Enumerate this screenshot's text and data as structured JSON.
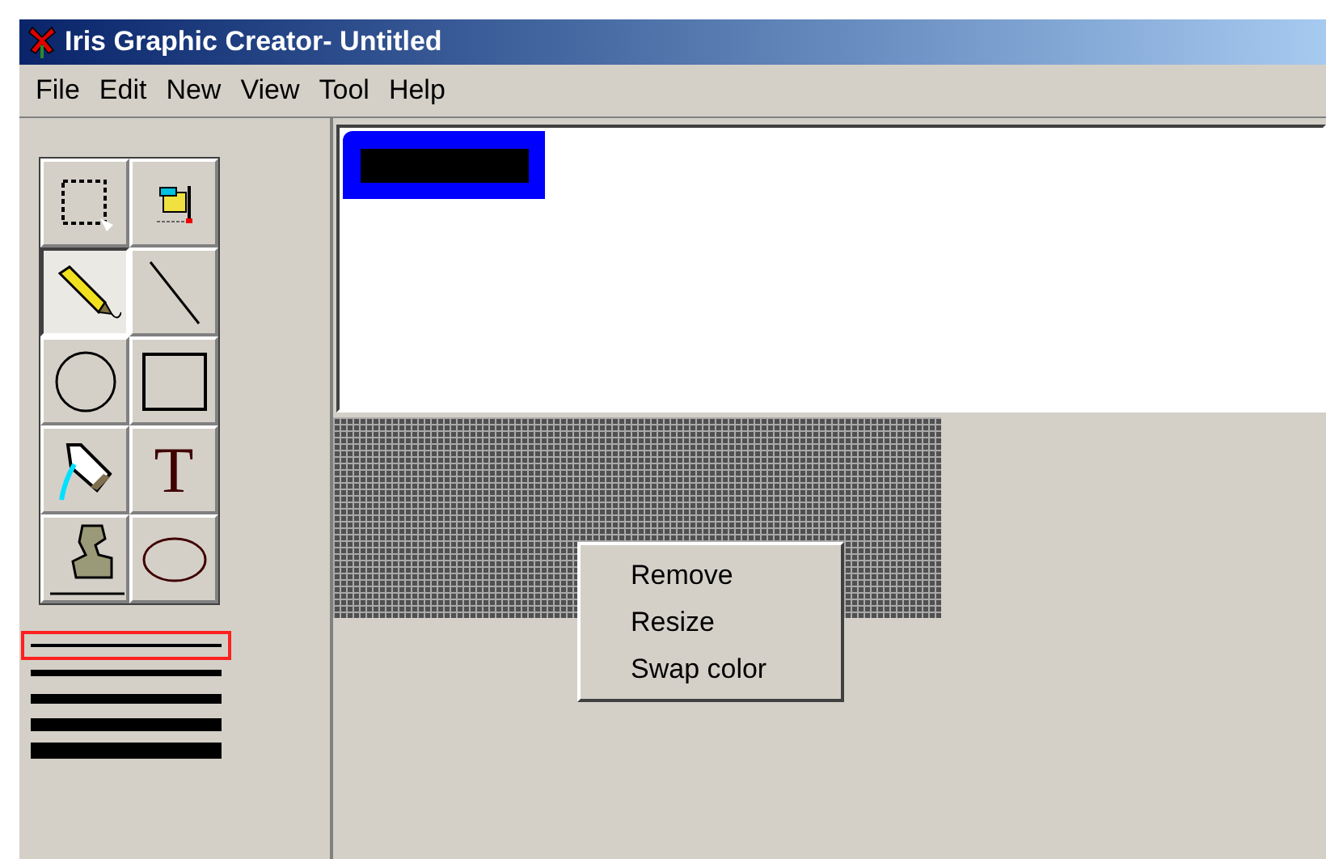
{
  "window": {
    "title": "Iris Graphic Creator- Untitled"
  },
  "menu": [
    "File",
    "Edit",
    "New",
    "View",
    "Tool",
    "Help"
  ],
  "tools": [
    {
      "kind": "select",
      "selected": false
    },
    {
      "kind": "picker",
      "selected": false
    },
    {
      "kind": "pencil",
      "selected": true
    },
    {
      "kind": "line",
      "selected": false
    },
    {
      "kind": "circle",
      "selected": false
    },
    {
      "kind": "rectangle",
      "selected": false
    },
    {
      "kind": "fill",
      "selected": false
    },
    {
      "kind": "text",
      "label": "T",
      "selected": false
    },
    {
      "kind": "stamp",
      "selected": false
    },
    {
      "kind": "ellipse",
      "selected": false
    }
  ],
  "line_widths": [
    {
      "selected": true
    },
    {
      "selected": false
    },
    {
      "selected": false
    },
    {
      "selected": false
    },
    {
      "selected": false
    }
  ],
  "context_menu": [
    "Remove",
    "Resize",
    "Swap color"
  ]
}
